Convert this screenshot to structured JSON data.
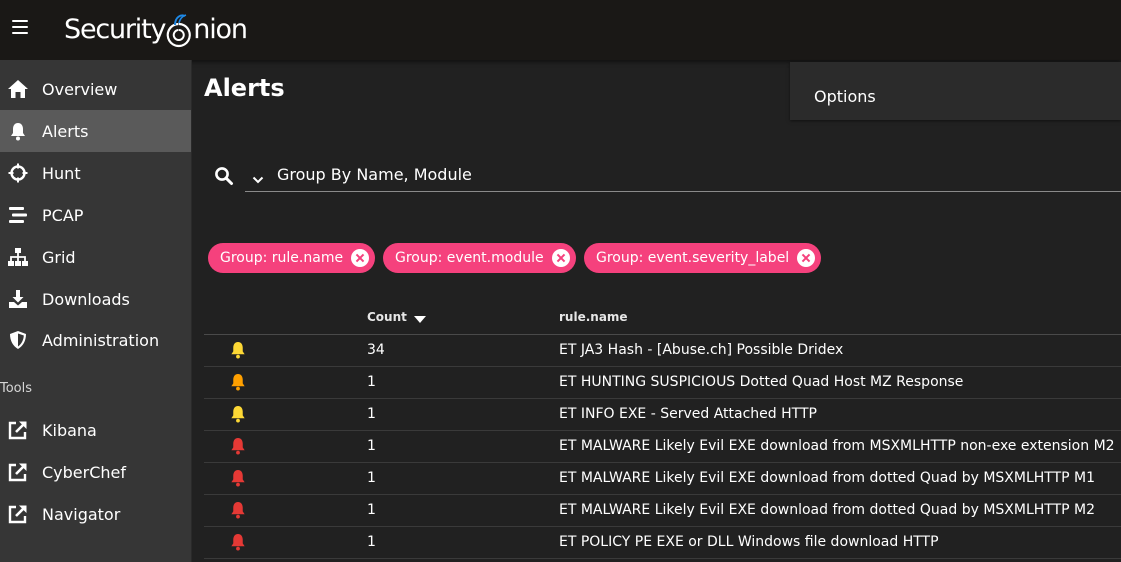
{
  "app": {
    "brand_left": "Security",
    "brand_right": "nion"
  },
  "nav": {
    "items": [
      {
        "label": "Overview",
        "icon": "home-icon"
      },
      {
        "label": "Alerts",
        "icon": "bell-icon"
      },
      {
        "label": "Hunt",
        "icon": "crosshair-icon"
      },
      {
        "label": "PCAP",
        "icon": "stream-icon"
      },
      {
        "label": "Grid",
        "icon": "sitemap-icon"
      },
      {
        "label": "Downloads",
        "icon": "download-icon"
      },
      {
        "label": "Administration",
        "icon": "shield-icon"
      }
    ],
    "tools_heading": "Tools",
    "tools": [
      {
        "label": "Kibana",
        "icon": "external-link-icon"
      },
      {
        "label": "CyberChef",
        "icon": "external-link-icon"
      },
      {
        "label": "Navigator",
        "icon": "external-link-icon"
      }
    ]
  },
  "page": {
    "title": "Alerts",
    "options_label": "Options"
  },
  "query": {
    "value": "Group By Name, Module"
  },
  "chips": [
    {
      "label": "Group: rule.name"
    },
    {
      "label": "Group: event.module"
    },
    {
      "label": "Group: event.severity_label"
    }
  ],
  "table": {
    "headers": {
      "count": "Count",
      "rule": "rule.name"
    },
    "rows": [
      {
        "severity": "medium",
        "count": "34",
        "rule": "ET JA3 Hash - [Abuse.ch] Possible Dridex"
      },
      {
        "severity": "high",
        "count": "1",
        "rule": "ET HUNTING SUSPICIOUS Dotted Quad Host MZ Response"
      },
      {
        "severity": "medium",
        "count": "1",
        "rule": "ET INFO EXE - Served Attached HTTP"
      },
      {
        "severity": "critical",
        "count": "1",
        "rule": "ET MALWARE Likely Evil EXE download from MSXMLHTTP non-exe extension M2"
      },
      {
        "severity": "critical",
        "count": "1",
        "rule": "ET MALWARE Likely Evil EXE download from dotted Quad by MSXMLHTTP M1"
      },
      {
        "severity": "critical",
        "count": "1",
        "rule": "ET MALWARE Likely Evil EXE download from dotted Quad by MSXMLHTTP M2"
      },
      {
        "severity": "critical",
        "count": "1",
        "rule": "ET POLICY PE EXE or DLL Windows file download HTTP"
      }
    ]
  },
  "colors": {
    "chip": "#f5417d",
    "severity_medium": "#fdd835",
    "severity_high": "#ffa000",
    "severity_critical": "#e53935",
    "brand_accent": "#1e88e5"
  }
}
